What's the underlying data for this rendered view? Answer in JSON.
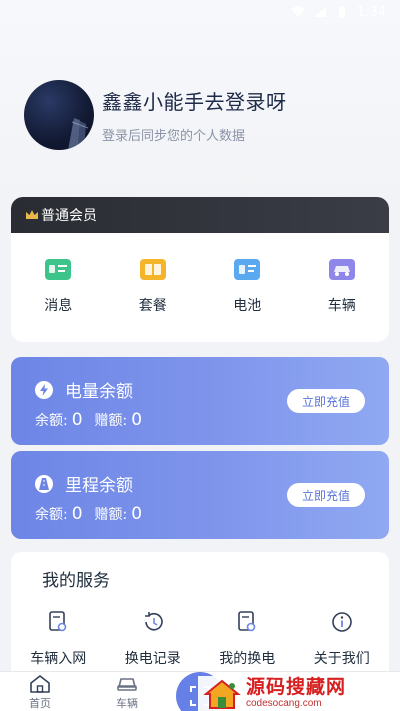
{
  "status_bar": {
    "time": "1:34"
  },
  "profile": {
    "name": "鑫鑫小能手去登录呀",
    "subtitle": "登录后同步您的个人数据"
  },
  "member": {
    "title": "普通会员",
    "items": [
      {
        "label": "消息",
        "icon": "message-icon",
        "color": "#3cc48a"
      },
      {
        "label": "套餐",
        "icon": "package-icon",
        "color": "#f5b52a"
      },
      {
        "label": "电池",
        "icon": "battery-icon",
        "color": "#5aa8f0"
      },
      {
        "label": "车辆",
        "icon": "vehicle-icon",
        "color": "#8f86ea"
      }
    ]
  },
  "balances": [
    {
      "title": "电量余额",
      "icon": "lightning-icon",
      "balance_label": "余额:",
      "balance": "0",
      "gift_label": "赠额:",
      "gift": "0",
      "button": "立即充值"
    },
    {
      "title": "里程余额",
      "icon": "road-icon",
      "balance_label": "余额:",
      "balance": "0",
      "gift_label": "赠额:",
      "gift": "0",
      "button": "立即充值"
    }
  ],
  "services": {
    "title": "我的服务",
    "items": [
      {
        "label": "车辆入网",
        "icon": "vehicle-register-icon"
      },
      {
        "label": "换电记录",
        "icon": "history-icon"
      },
      {
        "label": "我的换电",
        "icon": "swap-icon"
      },
      {
        "label": "关于我们",
        "icon": "info-icon"
      }
    ]
  },
  "bottom_nav": {
    "items": [
      {
        "label": "首页",
        "icon": "home-icon"
      },
      {
        "label": "车辆",
        "icon": "car-icon"
      }
    ]
  },
  "watermark": {
    "main": "源码搜藏网",
    "sub": "codesocang.com"
  },
  "colors": {
    "accent": "#6d86e6",
    "member_bar": "#2a2c33"
  }
}
